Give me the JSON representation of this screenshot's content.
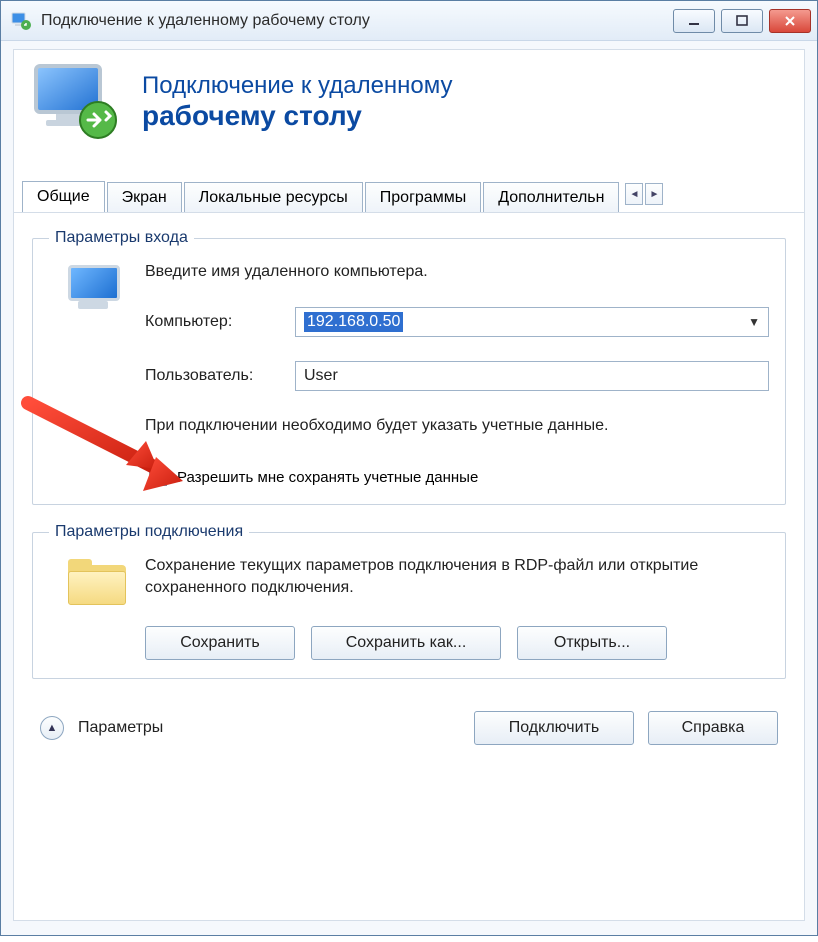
{
  "window": {
    "title": "Подключение к удаленному рабочему столу"
  },
  "banner": {
    "line1": "Подключение к удаленному",
    "line2": "рабочему столу"
  },
  "tabs": [
    "Общие",
    "Экран",
    "Локальные ресурсы",
    "Программы",
    "Дополнительн"
  ],
  "login": {
    "legend": "Параметры входа",
    "instruction": "Введите имя удаленного компьютера.",
    "computer_label": "Компьютер:",
    "computer_value": "192.168.0.50",
    "user_label": "Пользователь:",
    "user_value": "User",
    "hint": "При подключении необходимо будет указать учетные данные.",
    "save_creds_label": "Разрешить мне сохранять учетные данные"
  },
  "connection": {
    "legend": "Параметры подключения",
    "text": "Сохранение текущих параметров подключения в RDP-файл или открытие сохраненного подключения.",
    "save": "Сохранить",
    "save_as": "Сохранить как...",
    "open": "Открыть..."
  },
  "footer": {
    "params": "Параметры",
    "connect": "Подключить",
    "help": "Справка"
  }
}
